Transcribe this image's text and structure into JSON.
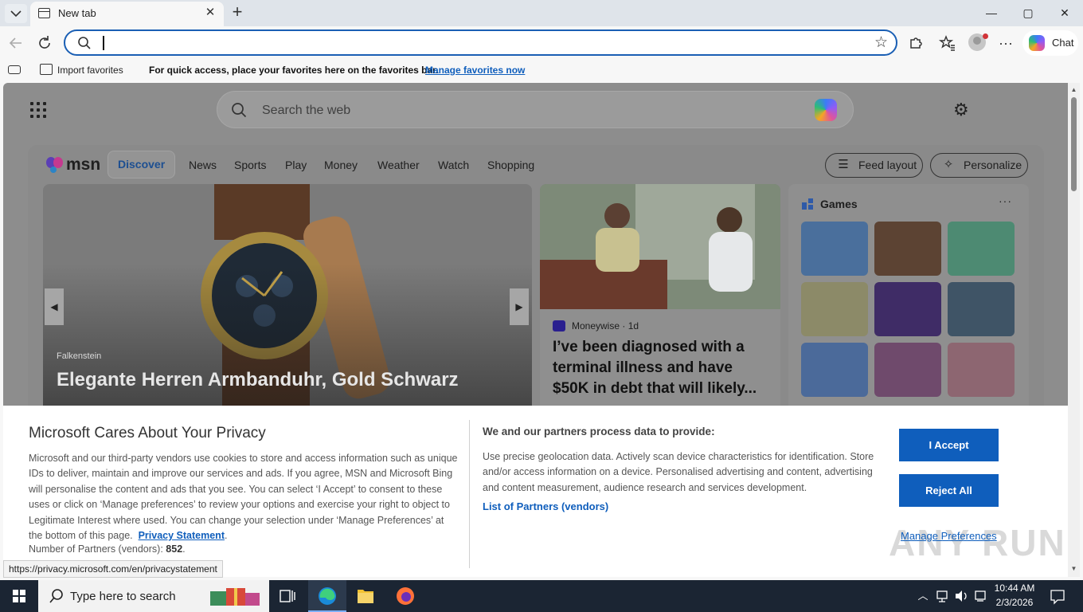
{
  "browser": {
    "tab_title": "New tab",
    "close_tab": "✕",
    "new_tab": "+",
    "window": {
      "minimize": "—",
      "maximize": "▢",
      "close": "✕"
    },
    "chat_label": "Chat"
  },
  "favorites_bar": {
    "import_label": "Import favorites",
    "message": "For quick access, place your favorites here on the favorites bar.",
    "manage_link": "Manage favorites now"
  },
  "newtab": {
    "search_placeholder": "Search the web",
    "msn_logo_text": "msn",
    "nav": [
      "Discover",
      "News",
      "Sports",
      "Play",
      "Money",
      "Weather",
      "Watch",
      "Shopping"
    ],
    "feed_layout_label": "Feed layout",
    "personalize_label": "Personalize",
    "hero": {
      "source": "Falkenstein",
      "title": "Elegante Herren Armbanduhr, Gold Schwarz"
    },
    "story": {
      "source": "Moneywise · 1d",
      "title": "I’ve been diagnosed with a terminal illness and have $50K in debt that will likely..."
    },
    "games": {
      "title": "Games",
      "more": "···"
    }
  },
  "privacy": {
    "title": "Microsoft Cares About Your Privacy",
    "body": "Microsoft and our third-party vendors use cookies to store and access information such as unique IDs to deliver, maintain and improve our services and ads. If you agree, MSN and Microsoft Bing will personalise the content and ads that you see. You can select ‘I Accept’ to consent to these uses or click on ‘Manage preferences’ to review your options and exercise your right to object to Legitimate Interest where used.  You can change your selection under ‘Manage Preferences’ at the bottom of this page.",
    "privacy_link": "Privacy Statement",
    "period": ".",
    "partners_count_label": "Number of Partners (vendors):",
    "partners_count": "852",
    "partners_suffix": ".",
    "heading2": "We and our partners process data to provide:",
    "body2": "Use precise geolocation data. Actively scan device characteristics for identification. Store and/or access information on a device. Personalised advertising and content, advertising and content measurement, audience research and services development.",
    "partners_link": "List of Partners (vendors)",
    "accept": "I Accept",
    "reject": "Reject All",
    "manage": "Manage Preferences"
  },
  "status_url": "https://privacy.microsoft.com/en/privacystatement",
  "watermark": "ANY RUN",
  "taskbar": {
    "search_placeholder": "Type here to search",
    "time": "10:44 AM",
    "date": "2/3/2026"
  },
  "colors": {
    "accent": "#0f5ebc",
    "omnibox_border": "#1a5fb4",
    "taskbar": "#1b2533"
  }
}
